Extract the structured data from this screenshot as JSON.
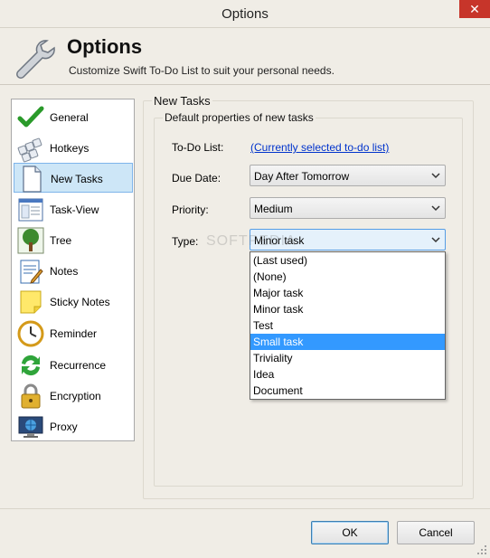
{
  "window": {
    "title": "Options",
    "close_glyph": "✕"
  },
  "header": {
    "title": "Options",
    "subtitle": "Customize Swift To-Do List to suit your personal needs."
  },
  "sidebar": {
    "items": [
      {
        "label": "General",
        "icon": "checkmark-icon"
      },
      {
        "label": "Hotkeys",
        "icon": "keyboard-icon"
      },
      {
        "label": "New Tasks",
        "icon": "document-icon",
        "selected": true
      },
      {
        "label": "Task-View",
        "icon": "window-icon"
      },
      {
        "label": "Tree",
        "icon": "tree-icon"
      },
      {
        "label": "Notes",
        "icon": "notepad-icon"
      },
      {
        "label": "Sticky Notes",
        "icon": "sticky-note-icon"
      },
      {
        "label": "Reminder",
        "icon": "clock-icon"
      },
      {
        "label": "Recurrence",
        "icon": "recurrence-icon"
      },
      {
        "label": "Encryption",
        "icon": "padlock-icon"
      },
      {
        "label": "Proxy",
        "icon": "globe-monitor-icon"
      }
    ]
  },
  "main": {
    "group_title": "New Tasks",
    "subgroup_title": "Default properties of new tasks",
    "todo_list": {
      "label": "To-Do List:",
      "value": "(Currently selected to-do list)"
    },
    "due_date": {
      "label": "Due Date:",
      "value": "Day After Tomorrow"
    },
    "priority": {
      "label": "Priority:",
      "value": "Medium"
    },
    "type": {
      "label": "Type:",
      "value": "Minor task",
      "options": [
        "(Last used)",
        "(None)",
        "Major task",
        "Minor task",
        "Test",
        "Small task",
        "Triviality",
        "Idea",
        "Document"
      ],
      "highlighted": "Small task"
    }
  },
  "watermark": "SOFTPEDIA",
  "footer": {
    "ok_label": "OK",
    "cancel_label": "Cancel"
  },
  "colors": {
    "selection": "#cde6f7",
    "highlight": "#3399ff",
    "link": "#0033cc",
    "close": "#c7352a"
  }
}
